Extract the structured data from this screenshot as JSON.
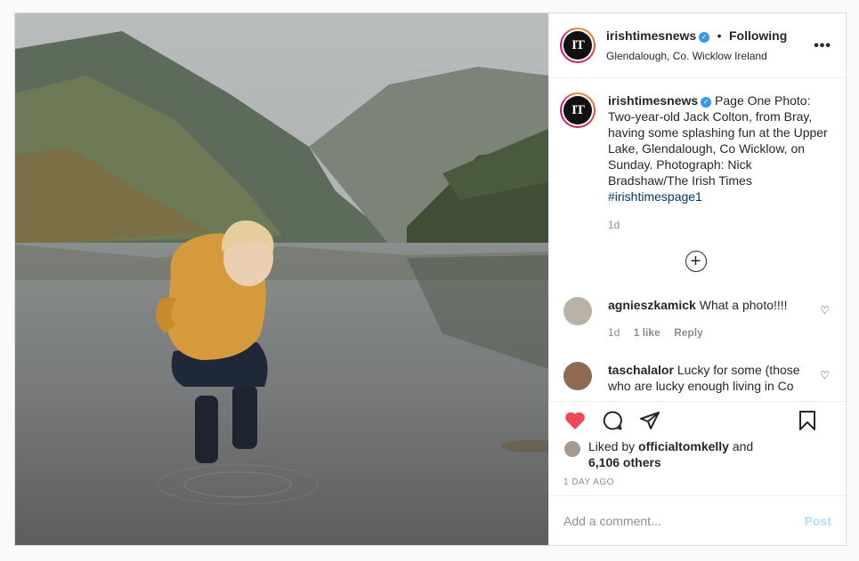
{
  "post": {
    "author": {
      "username": "irishtimesnews",
      "logo_text": "IT",
      "verified": true
    },
    "follow_dot": "•",
    "follow_label": "Following",
    "location": "Glendalough, Co. Wicklow Ireland",
    "more_label": "•••",
    "caption": {
      "username": "irishtimesnews",
      "text": "Page One Photo: Two-year-old Jack Colton, from Bray, having some splashing fun at the Upper Lake, Glendalough, Co Wicklow, on Sunday. Photograph: Nick Bradshaw/The Irish Times",
      "hashtag": "#irishtimespage1",
      "age": "1d"
    },
    "load_more_symbol": "+",
    "comments": [
      {
        "username": "agnieszkamick",
        "text": "What a photo!!!!",
        "age": "1d",
        "likes": "1 like",
        "reply_label": "Reply"
      },
      {
        "username": "taschalalor",
        "text": "Lucky for some (those who are lucky enough living in Co",
        "age": "",
        "likes": "",
        "reply_label": ""
      }
    ],
    "liked_by_prefix": "Liked by",
    "liked_by_user": "officialtomkelly",
    "liked_by_and": "and",
    "liked_by_others": "6,106 others",
    "timestamp": "1 DAY AGO",
    "comment_placeholder": "Add a comment...",
    "post_button": "Post",
    "icons": [
      "verified-badge-icon",
      "more-options-icon",
      "load-more-icon",
      "comment-heart-icon",
      "like-heart-icon",
      "comment-icon",
      "share-icon",
      "save-bookmark-icon"
    ],
    "colors": {
      "like_red": "#ed4956",
      "link_blue": "#00376b",
      "verified_blue": "#3897f0",
      "post_disabled": "#b2dffc",
      "muted": "#8e8e8e"
    }
  }
}
